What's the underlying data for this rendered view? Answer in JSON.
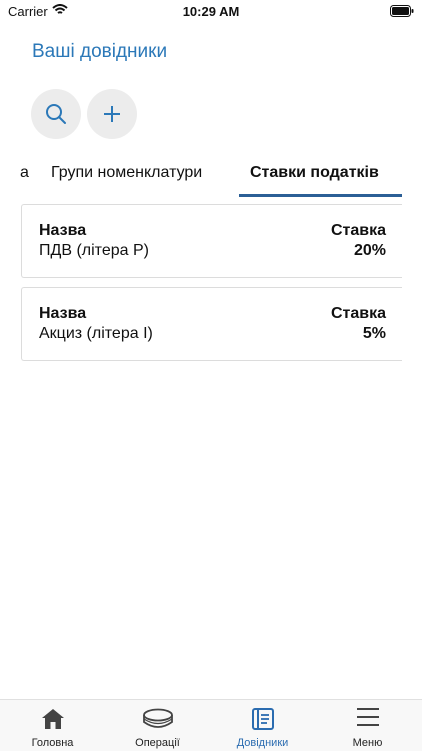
{
  "status_bar": {
    "carrier": "Carrier",
    "time": "10:29 AM"
  },
  "header": {
    "title": "Ваші довідники"
  },
  "tabs": [
    {
      "label": "а"
    },
    {
      "label": "Групи номенклатури"
    },
    {
      "label": "Ставки податків",
      "active": true
    }
  ],
  "cards": [
    {
      "name_label": "Назва",
      "name": "ПДВ (літера Р)",
      "rate_label": "Ставка",
      "rate": "20%"
    },
    {
      "name_label": "Назва",
      "name": "Акциз (літера І)",
      "rate_label": "Ставка",
      "rate": "5%"
    }
  ],
  "bottom_nav": [
    {
      "label": "Головна",
      "icon": "home-icon"
    },
    {
      "label": "Операції",
      "icon": "coins-icon"
    },
    {
      "label": "Довідники",
      "icon": "book-icon",
      "active": true
    },
    {
      "label": "Меню",
      "icon": "menu-icon"
    }
  ],
  "colors": {
    "accent": "#2b78b8",
    "active_nav": "#2b6cb0",
    "button_bg": "#ececec"
  }
}
